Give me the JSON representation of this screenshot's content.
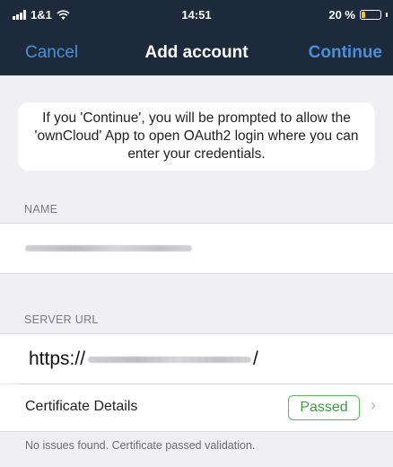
{
  "status_bar": {
    "carrier": "1&1",
    "time": "14:51",
    "battery_text": "20 %",
    "battery_level": 0.2
  },
  "nav": {
    "cancel_label": "Cancel",
    "title": "Add account",
    "continue_label": "Continue"
  },
  "info_message": "If you 'Continue', you will be prompted to allow the 'ownCloud' App to open OAuth2 login where you can enter your credentials.",
  "name_section": {
    "header": "NAME",
    "value_redacted": true
  },
  "server_section": {
    "header": "SERVER URL",
    "url_prefix": "https://",
    "url_suffix": "/"
  },
  "certificate": {
    "label": "Certificate Details",
    "status": "Passed",
    "note": "No issues found. Certificate passed validation."
  },
  "colors": {
    "nav_background": "#1c2a3c",
    "accent": "#4a90d9",
    "passed_green": "#5cb85c",
    "battery_yellow": "#f5c518"
  }
}
